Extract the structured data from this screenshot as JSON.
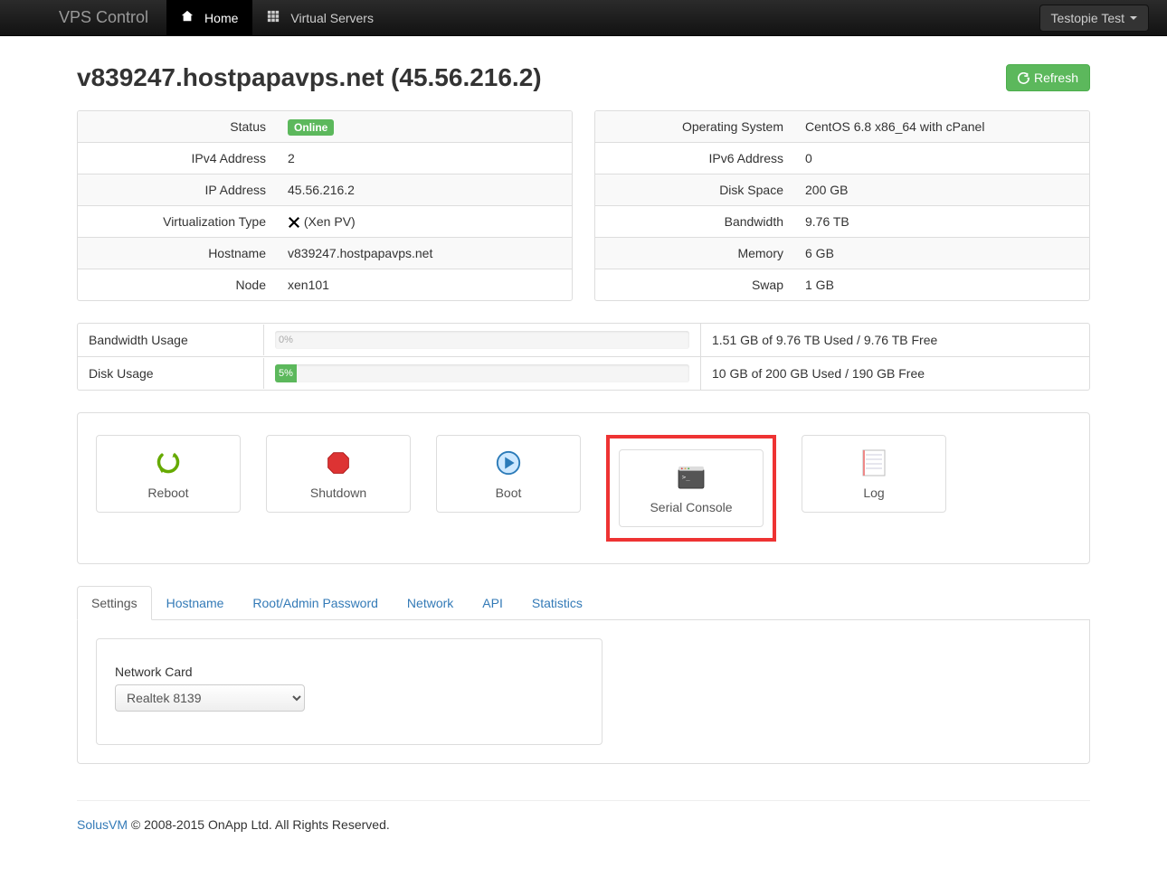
{
  "nav": {
    "brand": "VPS Control",
    "home": "Home",
    "servers": "Virtual Servers",
    "user": "Testopie Test"
  },
  "page": {
    "title": "v839247.hostpapavps.net (45.56.216.2)",
    "refresh": "Refresh"
  },
  "left": {
    "status_label": "Status",
    "status_value": "Online",
    "ipv4_label": "IPv4 Address",
    "ipv4_value": "2",
    "ip_label": "IP Address",
    "ip_value": "45.56.216.2",
    "virt_label": "Virtualization Type",
    "virt_value": "(Xen PV)",
    "host_label": "Hostname",
    "host_value": "v839247.hostpapavps.net",
    "node_label": "Node",
    "node_value": "xen101"
  },
  "right": {
    "os_label": "Operating System",
    "os_value": "CentOS 6.8 x86_64 with cPanel",
    "ipv6_label": "IPv6 Address",
    "ipv6_value": "0",
    "disk_label": "Disk Space",
    "disk_value": "200 GB",
    "bw_label": "Bandwidth",
    "bw_value": "9.76 TB",
    "mem_label": "Memory",
    "mem_value": "6 GB",
    "swap_label": "Swap",
    "swap_value": "1 GB"
  },
  "usage": {
    "bw_label": "Bandwidth Usage",
    "bw_pct": "0%",
    "bw_desc": "1.51 GB of 9.76 TB Used / 9.76 TB Free",
    "disk_label": "Disk Usage",
    "disk_pct": "5%",
    "disk_desc": "10 GB of 200 GB Used / 190 GB Free"
  },
  "actions": {
    "reboot": "Reboot",
    "shutdown": "Shutdown",
    "boot": "Boot",
    "serial": "Serial Console",
    "log": "Log"
  },
  "tabs": {
    "settings": "Settings",
    "hostname": "Hostname",
    "password": "Root/Admin Password",
    "network": "Network",
    "api": "API",
    "stats": "Statistics"
  },
  "settings": {
    "nic_label": "Network Card",
    "nic_value": "Realtek 8139"
  },
  "footer": {
    "brand": "SolusVM",
    "rest": " © 2008-2015 OnApp Ltd. All Rights Reserved."
  }
}
